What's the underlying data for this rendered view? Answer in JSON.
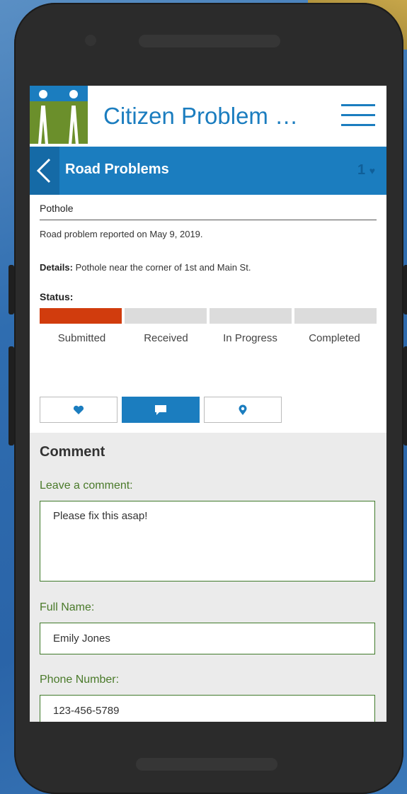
{
  "app": {
    "title": "Citizen Problem …"
  },
  "subheader": {
    "title": "Road Problems",
    "like_count": "1"
  },
  "problem": {
    "title": "Pothole",
    "reported": "Road problem reported on May 9, 2019.",
    "details_label": "Details:",
    "details_text": " Pothole near the corner of 1st and Main St.",
    "status_label": "Status:",
    "status_steps": [
      "Submitted",
      "Received",
      "In Progress",
      "Completed"
    ],
    "current_step": 1
  },
  "tabs": {
    "items": [
      "heart-icon",
      "comment-icon",
      "location-icon"
    ],
    "active": "comment-icon"
  },
  "comment": {
    "title": "Comment",
    "leave_label": "Leave a comment:",
    "comment_value": "Please fix this asap!",
    "name_label": "Full Name:",
    "name_value": "Emily Jones",
    "phone_label": "Phone Number:",
    "phone_value": "123-456-5789"
  },
  "colors": {
    "accent": "#1b7dbf",
    "status_active": "#d13c0d",
    "label_green": "#4a7a2a"
  }
}
